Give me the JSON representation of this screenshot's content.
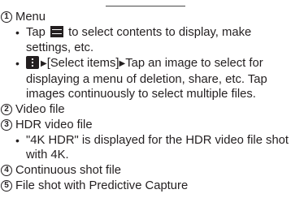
{
  "items": {
    "menu": {
      "num": "1",
      "title": "Menu"
    },
    "video": {
      "num": "2",
      "title": "Video file"
    },
    "hdr": {
      "num": "3",
      "title": "HDR video file"
    },
    "continuous": {
      "num": "4",
      "title": "Continuous shot file"
    },
    "predictive": {
      "num": "5",
      "title": "File shot with Predictive Capture"
    }
  },
  "menu_bullets": {
    "b1": {
      "pre": "Tap",
      "icon": "menu-icon",
      "post": "to select contents to display, make",
      "line2": "settings, etc."
    },
    "b2": {
      "icon": "more-options-icon",
      "select_items": "[Select items]",
      "post": "Tap an image to select for",
      "line2": "displaying a menu of deletion, share, etc. Tap",
      "line3": "images continuously to select multiple files."
    }
  },
  "hdr_bullet": {
    "line1": "\"4K HDR\" is displayed for the HDR video file shot",
    "line2": "with 4K."
  },
  "glyphs": {
    "bullet": "•",
    "arrow": "▶"
  }
}
